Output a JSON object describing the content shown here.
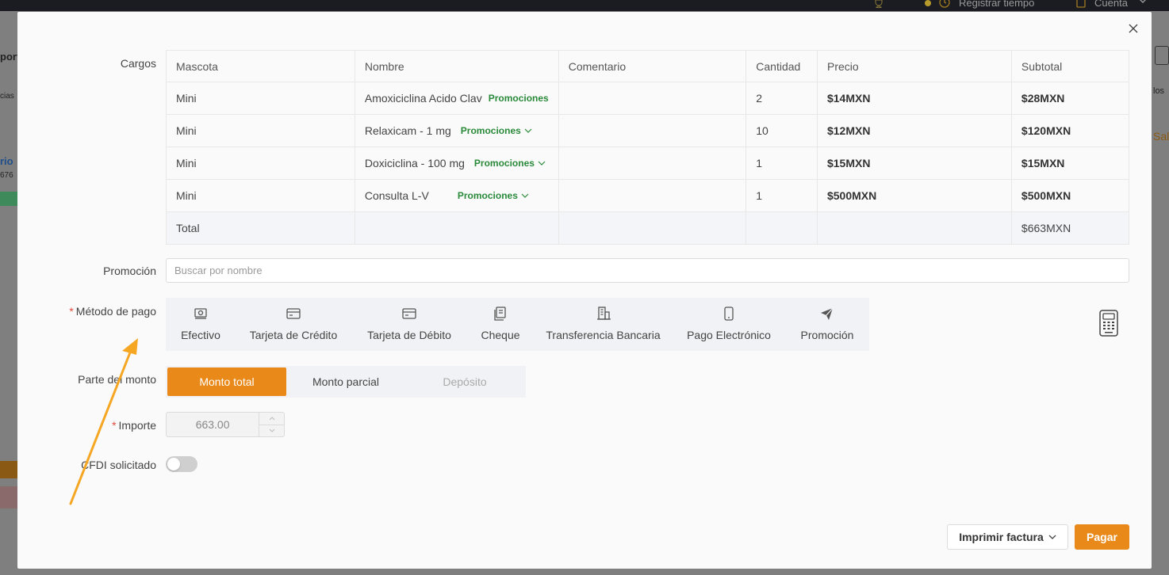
{
  "background": {
    "topbar": {
      "register_time": "Registrar tiempo",
      "account": "Cuenta"
    },
    "left_fragments": [
      "port",
      "cias",
      "rio",
      "676"
    ],
    "right_fragments": [
      "los",
      "Sal"
    ]
  },
  "modal": {
    "labels": {
      "charges": "Cargos",
      "promotion": "Promoción",
      "payment_method": "Método de pago",
      "amount_part": "Parte del monto",
      "amount": "Importe",
      "cfdi": "CFDI solicitado"
    },
    "required_mark": "*",
    "table": {
      "headers": [
        "Mascota",
        "Nombre",
        "Comentario",
        "Cantidad",
        "Precio",
        "Subtotal"
      ],
      "rows": [
        {
          "pet": "Mini",
          "name": "Amoxiciclina Acido Clav",
          "promo": "Promociones",
          "comment": "",
          "qty": "2",
          "price": "$14MXN",
          "subtotal": "$28MXN"
        },
        {
          "pet": "Mini",
          "name": "Relaxicam - 1 mg",
          "promo": "Promociones",
          "comment": "",
          "qty": "10",
          "price": "$12MXN",
          "subtotal": "$120MXN"
        },
        {
          "pet": "Mini",
          "name": "Doxiciclina - 100 mg",
          "promo": "Promociones",
          "comment": "",
          "qty": "1",
          "price": "$15MXN",
          "subtotal": "$15MXN"
        },
        {
          "pet": "Mini",
          "name": "Consulta L-V",
          "promo": "Promociones",
          "comment": "",
          "qty": "1",
          "price": "$500MXN",
          "subtotal": "$500MXN"
        }
      ],
      "total_label": "Total",
      "total_value": "$663MXN"
    },
    "promo_search_placeholder": "Buscar por nombre",
    "payment_methods": [
      {
        "label": "Efectivo",
        "icon": "cash-icon"
      },
      {
        "label": "Tarjeta de Crédito",
        "icon": "credit-card-icon"
      },
      {
        "label": "Tarjeta de Débito",
        "icon": "debit-card-icon"
      },
      {
        "label": "Cheque",
        "icon": "cheque-icon"
      },
      {
        "label": "Transferencia Bancaria",
        "icon": "bank-icon"
      },
      {
        "label": "Pago Electrónico",
        "icon": "phone-icon"
      },
      {
        "label": "Promoción",
        "icon": "send-icon"
      }
    ],
    "amount_parts": {
      "total": "Monto total",
      "partial": "Monto parcial",
      "deposit": "Depósito"
    },
    "amount_value": "663.00",
    "cfdi_enabled": false,
    "buttons": {
      "print": "Imprimir factura",
      "pay": "Pagar"
    },
    "colors": {
      "accent": "#e8891a",
      "promo_green": "#2a8a3a",
      "required": "#e24b3b",
      "annotation_arrow": "#f5a623"
    }
  }
}
